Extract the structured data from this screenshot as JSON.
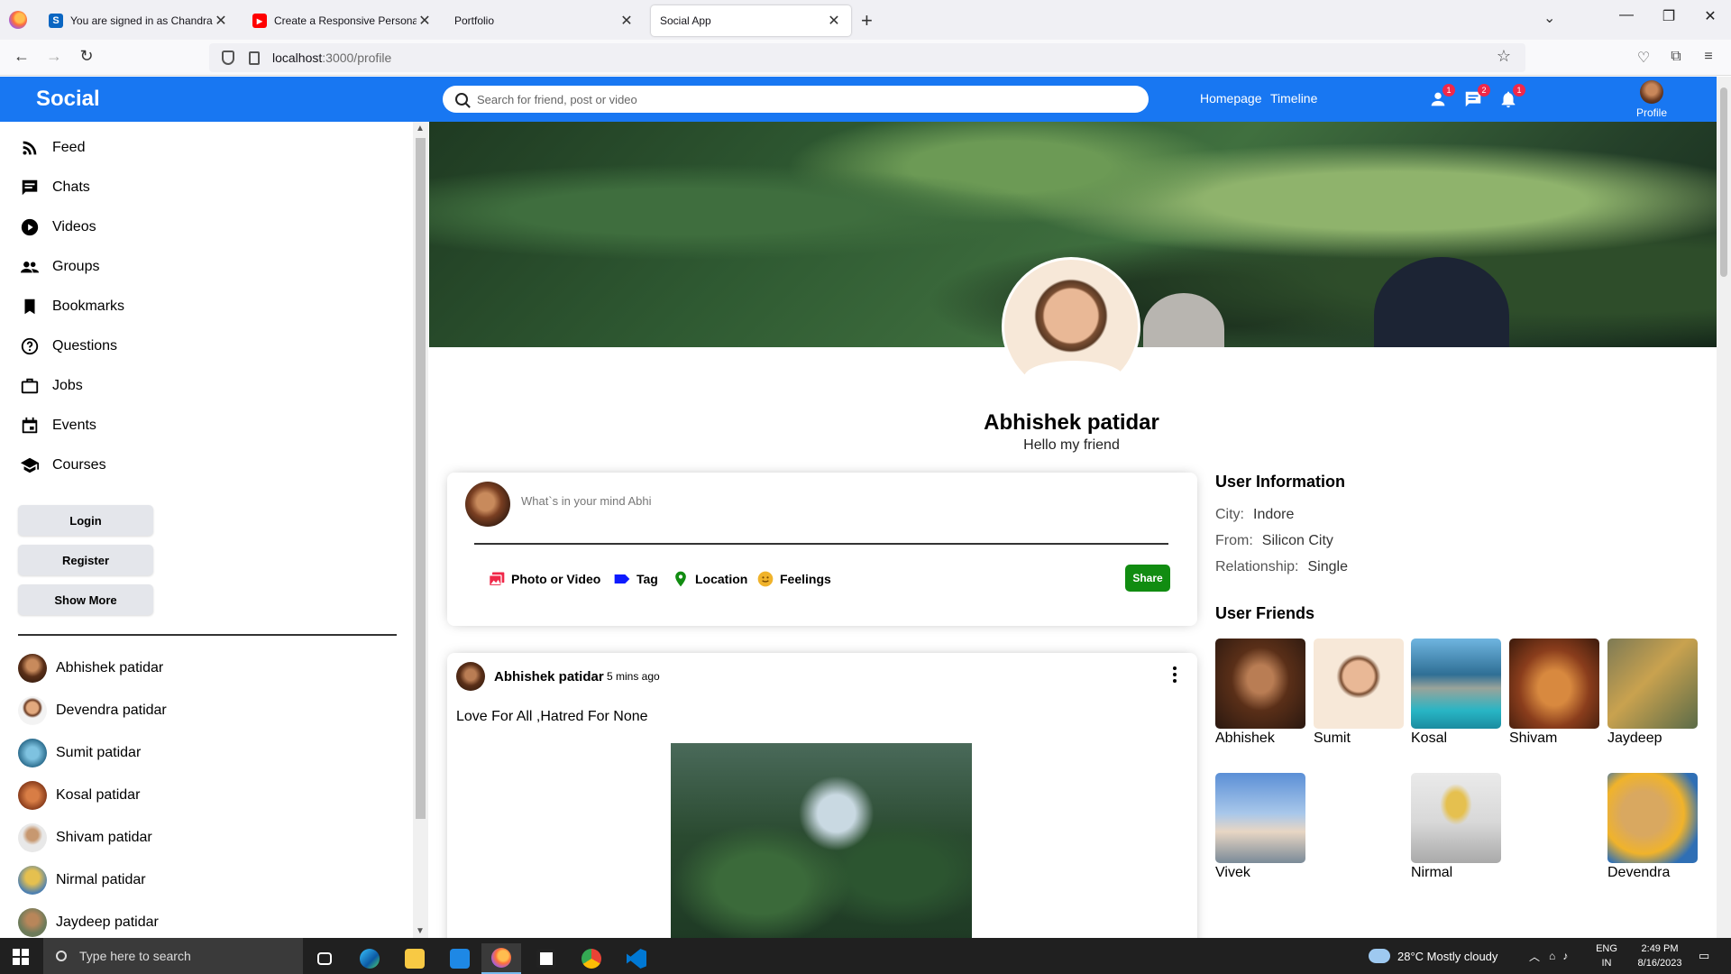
{
  "browser": {
    "tabs": [
      {
        "label": "You are signed in as Chandraka",
        "icon_color": "#0a66c2",
        "icon_text": "S",
        "active": false
      },
      {
        "label": "Create a Responsive Personal P",
        "icon_color": "#ff0000",
        "icon_text": "▶",
        "active": false
      },
      {
        "label": "Portfolio",
        "icon_color": "",
        "icon_text": "",
        "active": false
      },
      {
        "label": "Social App",
        "icon_color": "",
        "icon_text": "",
        "active": true
      }
    ],
    "url_host": "localhost",
    "url_path": ":3000/profile"
  },
  "topbar": {
    "logo": "Social",
    "search_placeholder": "Search for friend, post or video",
    "links": [
      "Homepage",
      "Timeline"
    ],
    "badges": {
      "person": "1",
      "chat": "2",
      "notifications": "1"
    },
    "profile_label": "Profile",
    "accent_color": "#1877f2"
  },
  "sidebar": {
    "items": [
      {
        "label": "Feed",
        "icon": "rss-icon"
      },
      {
        "label": "Chats",
        "icon": "chat-icon"
      },
      {
        "label": "Videos",
        "icon": "play-circle-icon"
      },
      {
        "label": "Groups",
        "icon": "group-icon"
      },
      {
        "label": "Bookmarks",
        "icon": "bookmark-icon"
      },
      {
        "label": "Questions",
        "icon": "help-circle-icon"
      },
      {
        "label": "Jobs",
        "icon": "briefcase-icon"
      },
      {
        "label": "Events",
        "icon": "calendar-icon"
      },
      {
        "label": "Courses",
        "icon": "school-icon"
      }
    ],
    "buttons": [
      "Login",
      "Register",
      "Show More"
    ],
    "friends": [
      "Abhishek patidar",
      "Devendra patidar",
      "Sumit patidar",
      "Kosal patidar",
      "Shivam patidar",
      "Nirmal patidar",
      "Jaydeep patidar"
    ]
  },
  "profile": {
    "name": "Abhishek patidar",
    "description": "Hello my friend"
  },
  "share": {
    "placeholder": "What`s in your mind Abhi",
    "options": [
      "Photo or Video",
      "Tag",
      "Location",
      "Feelings"
    ],
    "share_label": "Share"
  },
  "post": {
    "user": "Abhishek patidar",
    "time": "5 mins ago",
    "text": "Love For All ,Hatred For None"
  },
  "right": {
    "info_title": "User Information",
    "info": [
      {
        "key": "City:",
        "value": "Indore"
      },
      {
        "key": "From:",
        "value": "Silicon City"
      },
      {
        "key": "Relationship:",
        "value": "Single"
      }
    ],
    "friends_title": "User Friends",
    "friends": [
      "Abhishek",
      "Sumit",
      "Kosal",
      "Shivam",
      "Jaydeep",
      "Vivek",
      "Nirmal",
      "Devendra"
    ]
  },
  "taskbar": {
    "search_placeholder": "Type here to search",
    "weather": "28°C  Mostly cloudy",
    "lang": "ENG",
    "region": "IN",
    "time": "2:49 PM",
    "date": "8/16/2023"
  }
}
